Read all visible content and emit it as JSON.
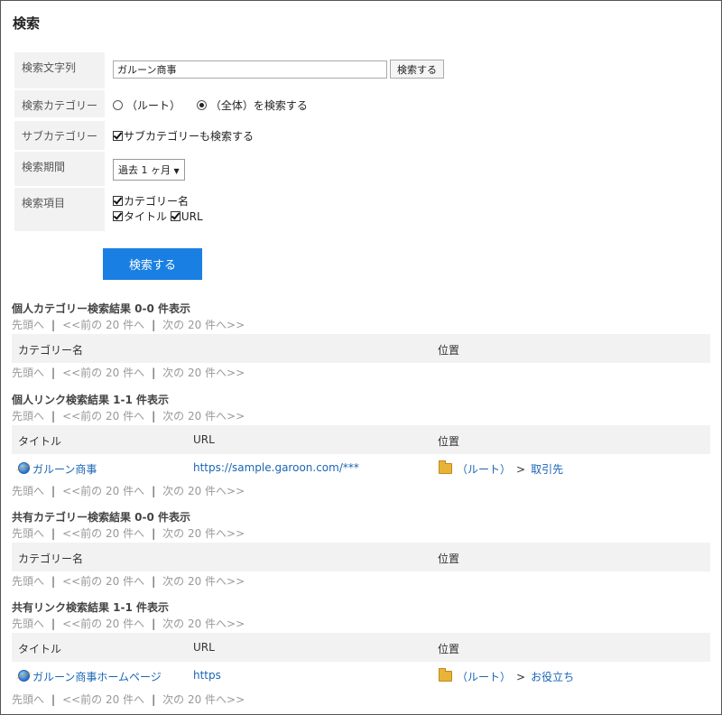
{
  "page": {
    "title": "検索"
  },
  "form": {
    "query_label": "検索文字列",
    "query_value": "ガルーン商事",
    "query_button": "検索する",
    "category_label": "検索カテゴリー",
    "category_opt_root": "（ルート）",
    "category_opt_all": "（全体）を検索する",
    "subcategory_label": "サブカテゴリー",
    "subcategory_check": "サブカテゴリーも検索する",
    "period_label": "検索期間",
    "period_value": "過去 1 ヶ月",
    "items_label": "検索項目",
    "item_category_name": "カテゴリー名",
    "item_title": "タイトル",
    "item_url": "URL",
    "submit_button": "検索する"
  },
  "pager": {
    "first": "先頭へ",
    "sep": "|",
    "prev": "<<前の 20 件へ",
    "next": "次の 20 件へ>>"
  },
  "personal_category": {
    "title": "個人カテゴリー検索結果 0-0 件表示",
    "col_name": "カテゴリー名",
    "col_location": "位置"
  },
  "personal_link": {
    "title": "個人リンク検索結果 1-1 件表示",
    "col_title": "タイトル",
    "col_url": "URL",
    "col_location": "位置",
    "rows": [
      {
        "title": "ガルーン商事",
        "url": "https://sample.garoon.com/***",
        "root": "（ルート）",
        "child": "取引先"
      }
    ]
  },
  "shared_category": {
    "title": "共有カテゴリー検索結果 0-0 件表示",
    "col_name": "カテゴリー名",
    "col_location": "位置"
  },
  "shared_link": {
    "title": "共有リンク検索結果 1-1 件表示",
    "col_title": "タイトル",
    "col_url": "URL",
    "col_location": "位置",
    "rows": [
      {
        "title": "ガルーン商事ホームページ",
        "url": "https",
        "root": "（ルート）",
        "child": "お役立ち"
      }
    ]
  },
  "crumb_sep": ">",
  "icons": {
    "link": "globe-link-icon",
    "location": "folder-icon",
    "dropdown": "chevron-down-icon"
  },
  "colors": {
    "primary_button": "#1a7fe2",
    "link": "#1a65b5",
    "label_bg": "#f2f2f2"
  }
}
